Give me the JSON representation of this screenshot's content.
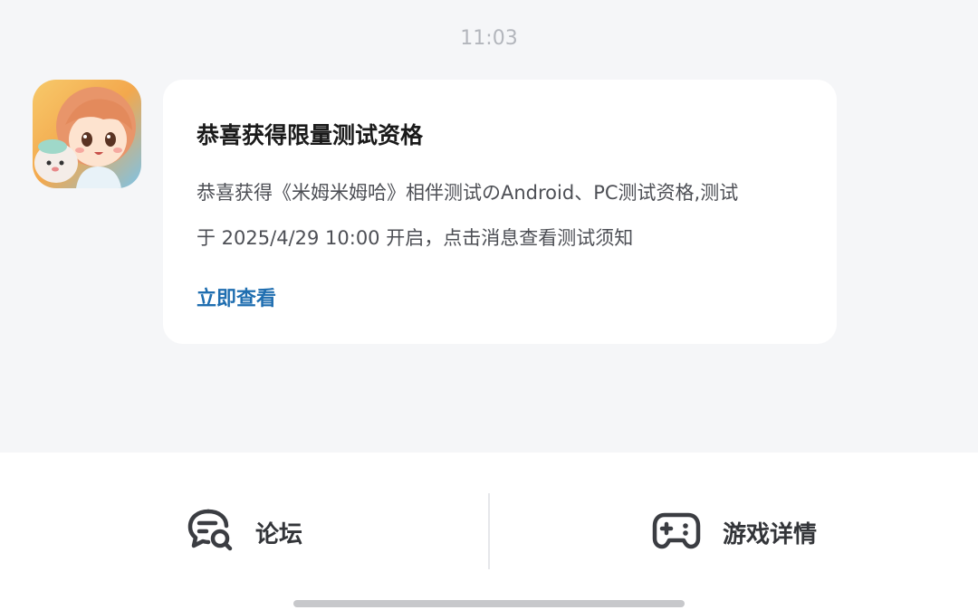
{
  "timestamp": "11:03",
  "message": {
    "avatar_icon": "game-app-icon",
    "title": "恭喜获得限量测试资格",
    "body_line1": "恭喜获得《米姆米姆哈》相伴测试のAndroid、PC测试资格,测试",
    "body_line2": "于 2025/4/29 10:00 开启，点击消息查看测试须知",
    "link_label": "立即查看",
    "link_color": "#1f6eb0"
  },
  "bottom_bar": {
    "forum": {
      "icon": "chat-search-icon",
      "label": "论坛"
    },
    "game_details": {
      "icon": "gamepad-icon",
      "label": "游戏详情"
    }
  }
}
